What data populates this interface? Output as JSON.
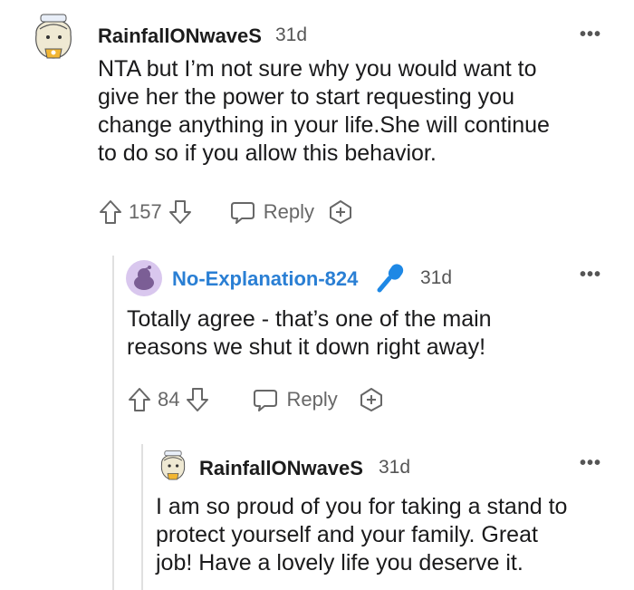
{
  "comments": [
    {
      "username": "RainfallONwaveS",
      "time": "31d",
      "more": "•••",
      "body_lines": [
        "NTA but I’m not sure why you would want to",
        "give her the power to start requesting you",
        "change anything in your life.She will continue",
        "to do so if you allow this behavior."
      ],
      "votes": "157",
      "reply_label": "Reply"
    },
    {
      "username": "No-Explanation-824",
      "time": "31d",
      "more": "•••",
      "body_lines": [
        "Totally agree - that’s one of the main",
        "reasons we shut it down right away!"
      ],
      "votes": "84",
      "reply_label": "Reply"
    },
    {
      "username": "RainfallONwaveS",
      "time": "31d",
      "more": "•••",
      "body_lines": [
        "I am so proud of you for taking a stand to",
        "protect yourself and your family. Great",
        "job! Have a lovely life you deserve it."
      ]
    }
  ],
  "colors": {
    "op_username": "#2a7fd4",
    "mic_badge": "#1e88e5",
    "avatar_purple": "#d9c7ee"
  },
  "icons": [
    "avatar-anime-girl",
    "avatar-snoo",
    "microphone-icon",
    "upvote-icon",
    "downvote-icon",
    "comment-bubble-icon",
    "award-plus-icon",
    "more-options-icon"
  ]
}
